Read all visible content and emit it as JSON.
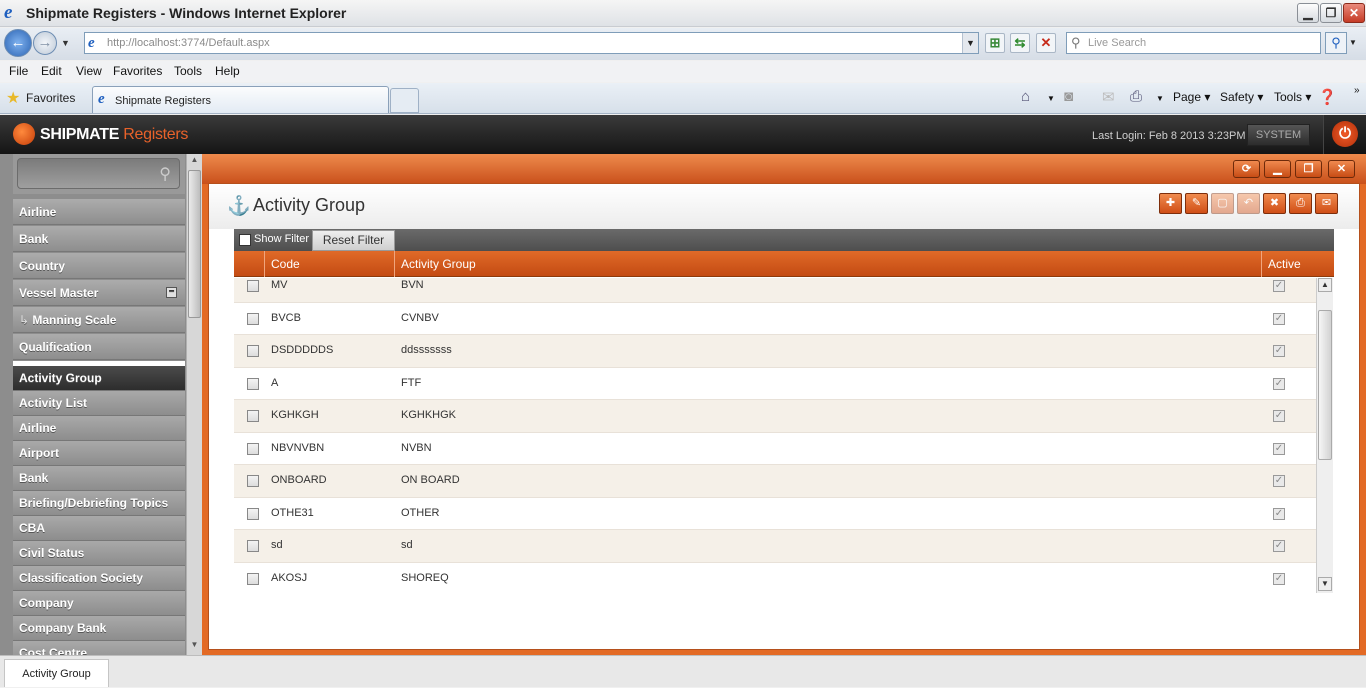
{
  "window": {
    "title": "Shipmate Registers - Windows Internet Explorer",
    "controls": {
      "minimize": "▁",
      "restore": "❐",
      "close": "✕"
    }
  },
  "browser": {
    "address": "http://localhost:3774/Default.aspx",
    "search_placeholder": "Live Search",
    "menu": [
      "File",
      "Edit",
      "View",
      "Favorites",
      "Tools",
      "Help"
    ],
    "favorites_label": "Favorites",
    "tab_title": "Shipmate Registers",
    "commands": {
      "page": "Page ▾",
      "safety": "Safety ▾",
      "tools": "Tools ▾"
    }
  },
  "app": {
    "brand": "SHIPMATE",
    "brand2": "Registers",
    "last_login": "Last Login: Feb 8 2013 3:23PM",
    "user": "SYSTEM"
  },
  "sidebar": {
    "top_items": [
      "Airline",
      "Bank",
      "Country",
      "Vessel Master",
      "Manning Scale",
      "Qualification"
    ],
    "items": [
      "Activity Group",
      "Activity List",
      "Airline",
      "Airport",
      "Bank",
      "Briefing/Debriefing Topics",
      "CBA",
      "Civil Status",
      "Classification Society",
      "Company",
      "Company Bank",
      "Cost Centre"
    ]
  },
  "main": {
    "title": "Activity Group",
    "filter_label": "Show Filter",
    "reset_label": "Reset Filter",
    "columns": {
      "code": "Code",
      "group": "Activity Group",
      "active": "Active"
    },
    "rows": [
      {
        "code": "MV",
        "group": "BVN",
        "active": true
      },
      {
        "code": "BVCB",
        "group": "CVNBV",
        "active": true
      },
      {
        "code": "DSDDDDDS",
        "group": "ddsssssss",
        "active": true
      },
      {
        "code": "A",
        "group": "FTF",
        "active": true
      },
      {
        "code": "KGHKGH",
        "group": "KGHKHGK",
        "active": true
      },
      {
        "code": "NBVNVBN",
        "group": "NVBN",
        "active": true
      },
      {
        "code": "ONBOARD",
        "group": "ON BOARD",
        "active": true
      },
      {
        "code": "OTHE31",
        "group": "OTHER",
        "active": true
      },
      {
        "code": "sd",
        "group": "sd",
        "active": true
      },
      {
        "code": "AKOSJ",
        "group": "SHOREQ",
        "active": true
      }
    ]
  },
  "statusbar": {
    "tab": "Activity Group"
  },
  "colors": {
    "accent": "#e36a25",
    "header_dark": "#1a1a1a",
    "sidebar": "#8d8d8d"
  }
}
